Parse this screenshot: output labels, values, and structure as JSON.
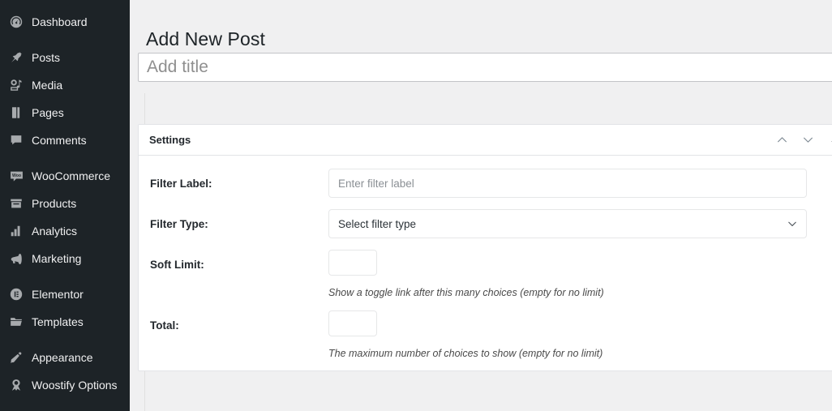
{
  "sidebar": {
    "groups": [
      {
        "items": [
          {
            "label": "Dashboard",
            "icon": "dashboard-gauge-icon"
          }
        ]
      },
      {
        "items": [
          {
            "label": "Posts",
            "icon": "pushpin-icon"
          },
          {
            "label": "Media",
            "icon": "media-camera-icon"
          },
          {
            "label": "Pages",
            "icon": "pages-book-icon"
          },
          {
            "label": "Comments",
            "icon": "comment-bubble-icon"
          }
        ]
      },
      {
        "items": [
          {
            "label": "WooCommerce",
            "icon": "woocommerce-icon"
          },
          {
            "label": "Products",
            "icon": "products-box-icon"
          },
          {
            "label": "Analytics",
            "icon": "analytics-bar-chart-icon"
          },
          {
            "label": "Marketing",
            "icon": "marketing-megaphone-icon"
          }
        ]
      },
      {
        "items": [
          {
            "label": "Elementor",
            "icon": "elementor-icon"
          },
          {
            "label": "Templates",
            "icon": "templates-folder-icon"
          }
        ]
      },
      {
        "items": [
          {
            "label": "Appearance",
            "icon": "appearance-brush-icon"
          },
          {
            "label": "Woostify Options",
            "icon": "woostify-icon"
          }
        ]
      }
    ]
  },
  "editor": {
    "page_title": "Add New Post",
    "title_placeholder": "Add title"
  },
  "panel": {
    "title": "Settings",
    "actions": {
      "move_up": "chevron-up-icon",
      "move_down": "chevron-down-icon",
      "collapse": "triangle-up-icon"
    },
    "fields": {
      "filter_label": {
        "label": "Filter Label:",
        "placeholder": "Enter filter label",
        "value": ""
      },
      "filter_type": {
        "label": "Filter Type:",
        "selected": "Select filter type"
      },
      "soft_limit": {
        "label": "Soft Limit:",
        "value": "",
        "help": "Show a toggle link after this many choices (empty for no limit)"
      },
      "total": {
        "label": "Total:",
        "value": "",
        "help": "The maximum number of choices to show (empty for no limit)"
      }
    }
  },
  "colors": {
    "sidebar_bg": "#1d2327",
    "sidebar_icon": "#a7aaad",
    "canvas_bg": "#f0f0f1",
    "panel_bg": "#ffffff",
    "border": "#e2e4e7",
    "text": "#1d2327"
  }
}
